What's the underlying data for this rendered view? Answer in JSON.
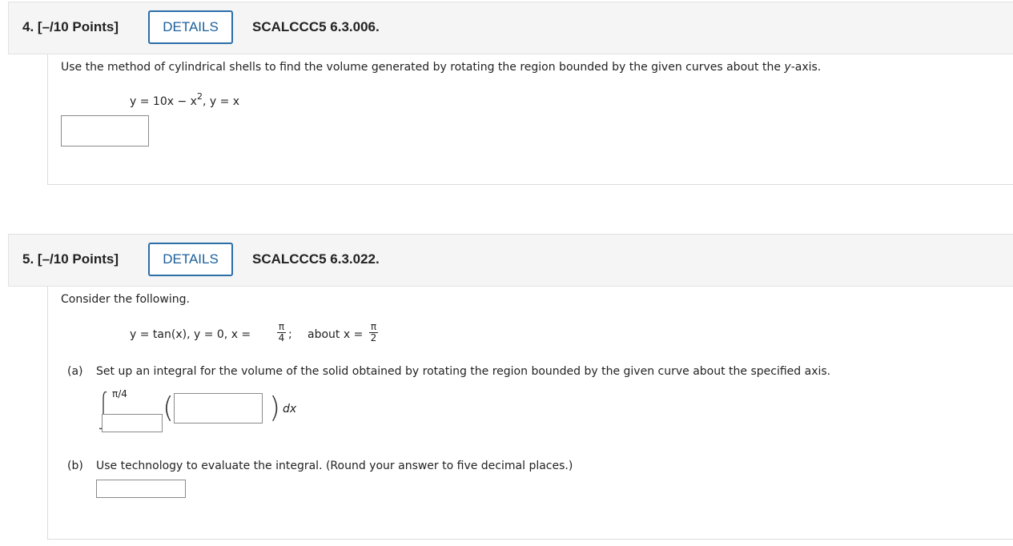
{
  "q4": {
    "number": "4.",
    "points": "[–/10 Points]",
    "details_label": "DETAILS",
    "code": "SCALCCC5 6.3.006.",
    "prompt_pre": "Use the method of cylindrical shells to find the volume generated by rotating the region bounded by the given curves about the ",
    "prompt_axis": "y",
    "prompt_post": "-axis.",
    "eq1": "y = 10x − x",
    "eq1_exp": "2",
    "eq2": ",   y = x",
    "answer_value": ""
  },
  "q5": {
    "number": "5.",
    "points": "[–/10 Points]",
    "details_label": "DETAILS",
    "code": "SCALCCC5 6.3.022.",
    "intro": "Consider the following.",
    "curves": "y = tan(x),   y = 0,   x =",
    "frac1_num": "π",
    "frac1_den": "4",
    "semicolon": ";",
    "about_label": "about x =",
    "frac2_num": "π",
    "frac2_den": "2",
    "part_a_label": "(a)",
    "part_a_text": "Set up an integral for the volume of the solid obtained by rotating the region bounded by the given curve about the specified axis.",
    "upper_limit": "π/4",
    "lower_limit_value": "",
    "integrand_value": "",
    "dx": "dx",
    "part_b_label": "(b)",
    "part_b_text": "Use technology to evaluate the integral. (Round your answer to five decimal places.)",
    "part_b_value": ""
  }
}
